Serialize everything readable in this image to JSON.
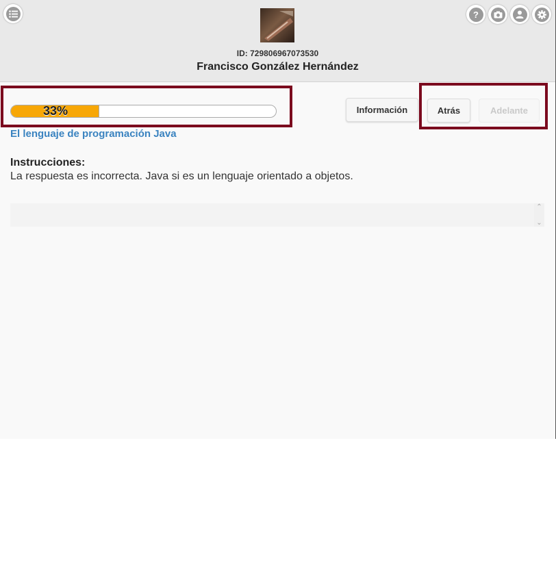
{
  "header": {
    "user_id": "ID: 729806967073530",
    "user_name": "Francisco González Hernández"
  },
  "icons": {
    "menu": "list-icon",
    "help": "question-icon",
    "camera": "camera-icon",
    "profile": "user-icon",
    "settings": "gear-icon"
  },
  "progress": {
    "label": "33%",
    "value": 0.33,
    "fill_color": "#f7a707"
  },
  "buttons": {
    "info": "Información",
    "back": "Atrás",
    "next": "Adelante"
  },
  "content": {
    "lesson_title": "El lenguaje de programación Java",
    "instructions_heading": "Instrucciones:",
    "instructions_text": "La respuesta es incorrecta. Java si es un lenguaje orientado a objetos."
  },
  "colors": {
    "accent_link": "#3a83c0",
    "highlight_border": "#7b0a1e"
  }
}
